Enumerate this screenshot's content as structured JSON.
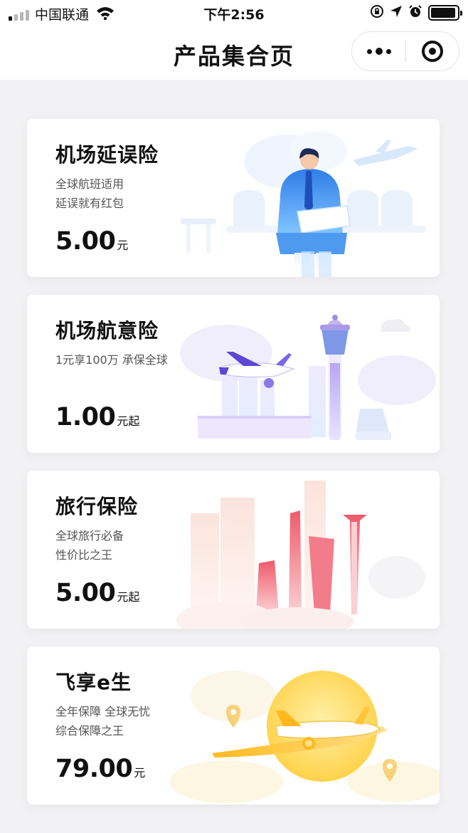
{
  "status_bar": {
    "carrier": "中国联通",
    "time": "下午2:56",
    "signal_bars_active": 1,
    "battery_level": 0.95
  },
  "nav": {
    "title": "产品集合页",
    "more_icon": "more-dots-icon",
    "close_icon": "target-circle-icon"
  },
  "cards": [
    {
      "title": "机场延误险",
      "desc_lines": [
        "全球航班适用",
        "延误就有红包"
      ],
      "price": "5.00",
      "unit": "元",
      "illustration": "man-reading-in-airport-seat"
    },
    {
      "title": "机场航意险",
      "desc_lines": [
        "1元享100万 承保全球",
        ""
      ],
      "price": "1.00",
      "unit": "元起",
      "illustration": "airplane-and-control-tower"
    },
    {
      "title": "旅行保险",
      "desc_lines": [
        "全球旅行必备",
        "性价比之王"
      ],
      "price": "5.00",
      "unit": "元起",
      "illustration": "city-skyline"
    },
    {
      "title": "飞享e生",
      "desc_lines": [
        "全年保障 全球无忧",
        "综合保障之王"
      ],
      "price": "79.00",
      "unit": "元",
      "illustration": "airplane-over-sun"
    }
  ]
}
